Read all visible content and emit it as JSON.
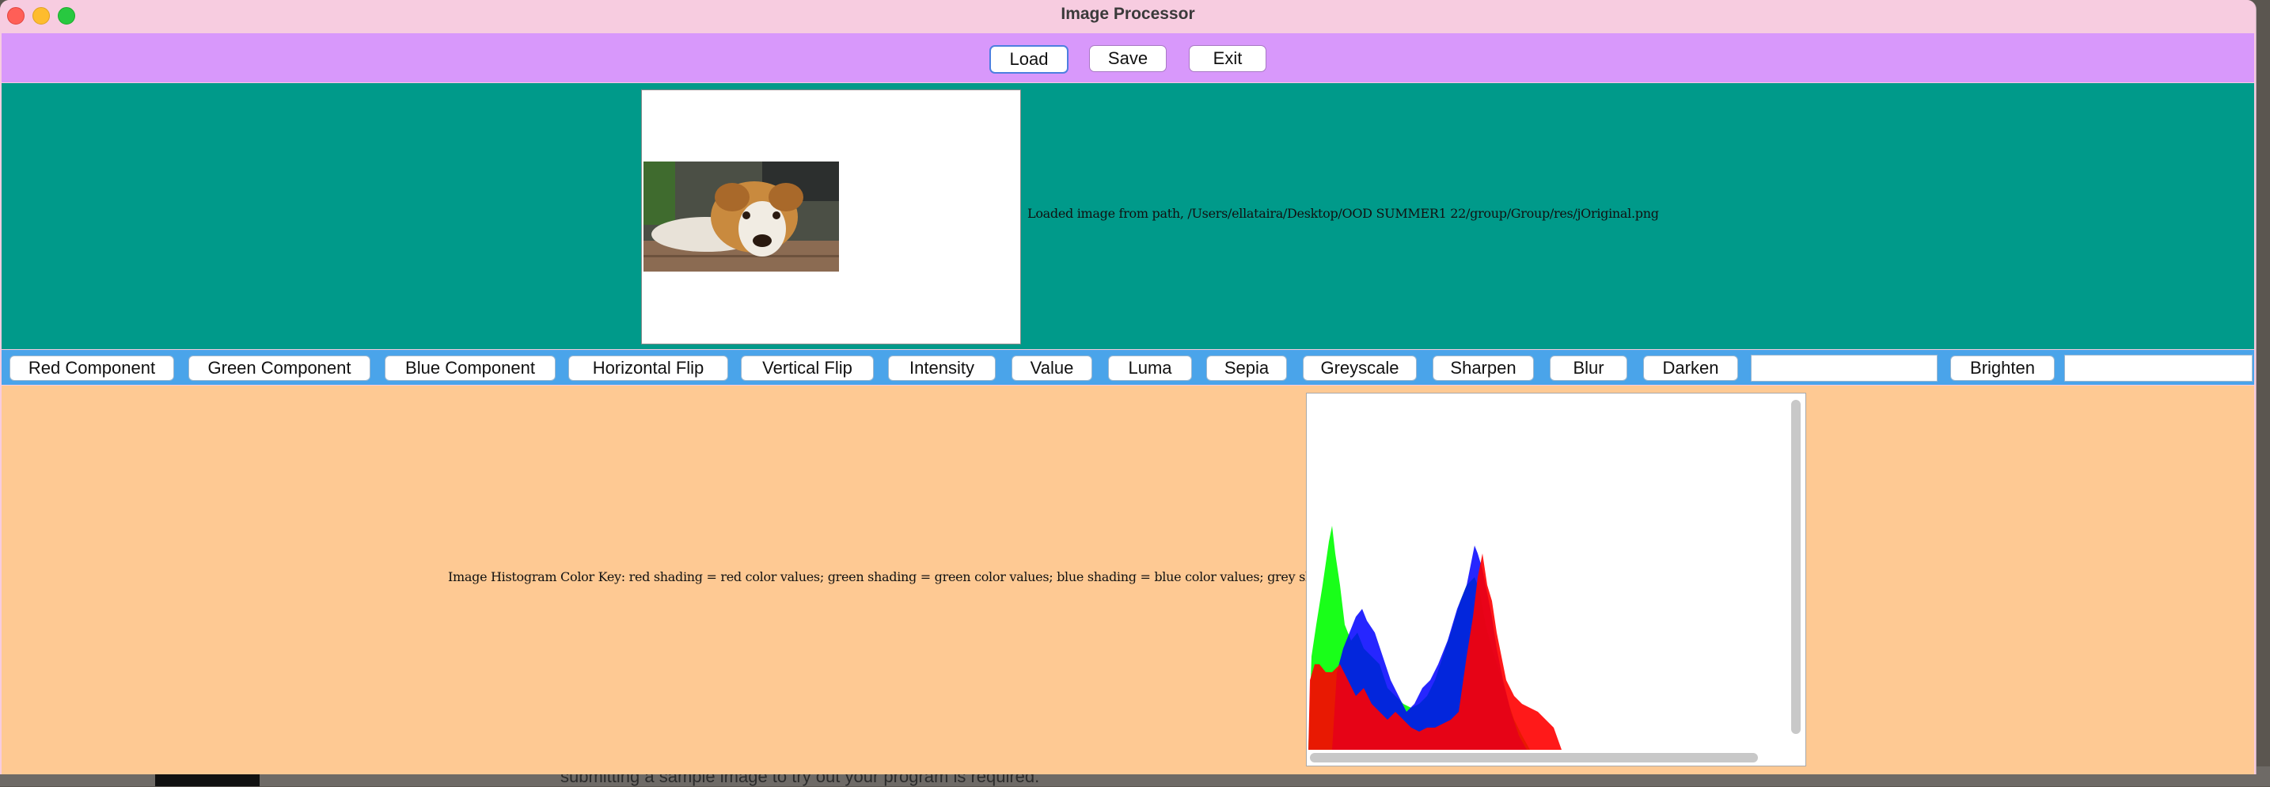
{
  "window": {
    "title": "Image Processor"
  },
  "file_buttons": {
    "load": "Load",
    "save": "Save",
    "exit": "Exit"
  },
  "status": {
    "text": "Loaded image from path, /Users/ellataira/Desktop/OOD SUMMER1 22/group/Group/res/jOriginal.png"
  },
  "operations": {
    "red": "Red Component",
    "green": "Green Component",
    "blue": "Blue Component",
    "hflip": "Horizontal Flip",
    "vflip": "Vertical Flip",
    "intensity": "Intensity",
    "value": "Value",
    "luma": "Luma",
    "sepia": "Sepia",
    "greyscale": "Greyscale",
    "sharpen": "Sharpen",
    "blur": "Blur",
    "darken": "Darken",
    "darken_amount": "",
    "brighten": "Brighten",
    "brighten_amount": ""
  },
  "histogram": {
    "key": "Image Histogram Color Key: red shading = red color values; green shading = green color values; blue shading = blue color values; grey shading = intensity values",
    "colors": {
      "red": "#ff0000",
      "green": "#00ff00",
      "blue": "#0000ff",
      "grey": "#808080"
    }
  },
  "background": {
    "text": "submitting a sample image to try out your program is required."
  },
  "colors": {
    "title_bar": "#f7cce0",
    "file_panel": "#d898fb",
    "image_panel": "#009a8a",
    "ops_panel": "#4aa4ea",
    "histogram_panel": "#fec993"
  }
}
